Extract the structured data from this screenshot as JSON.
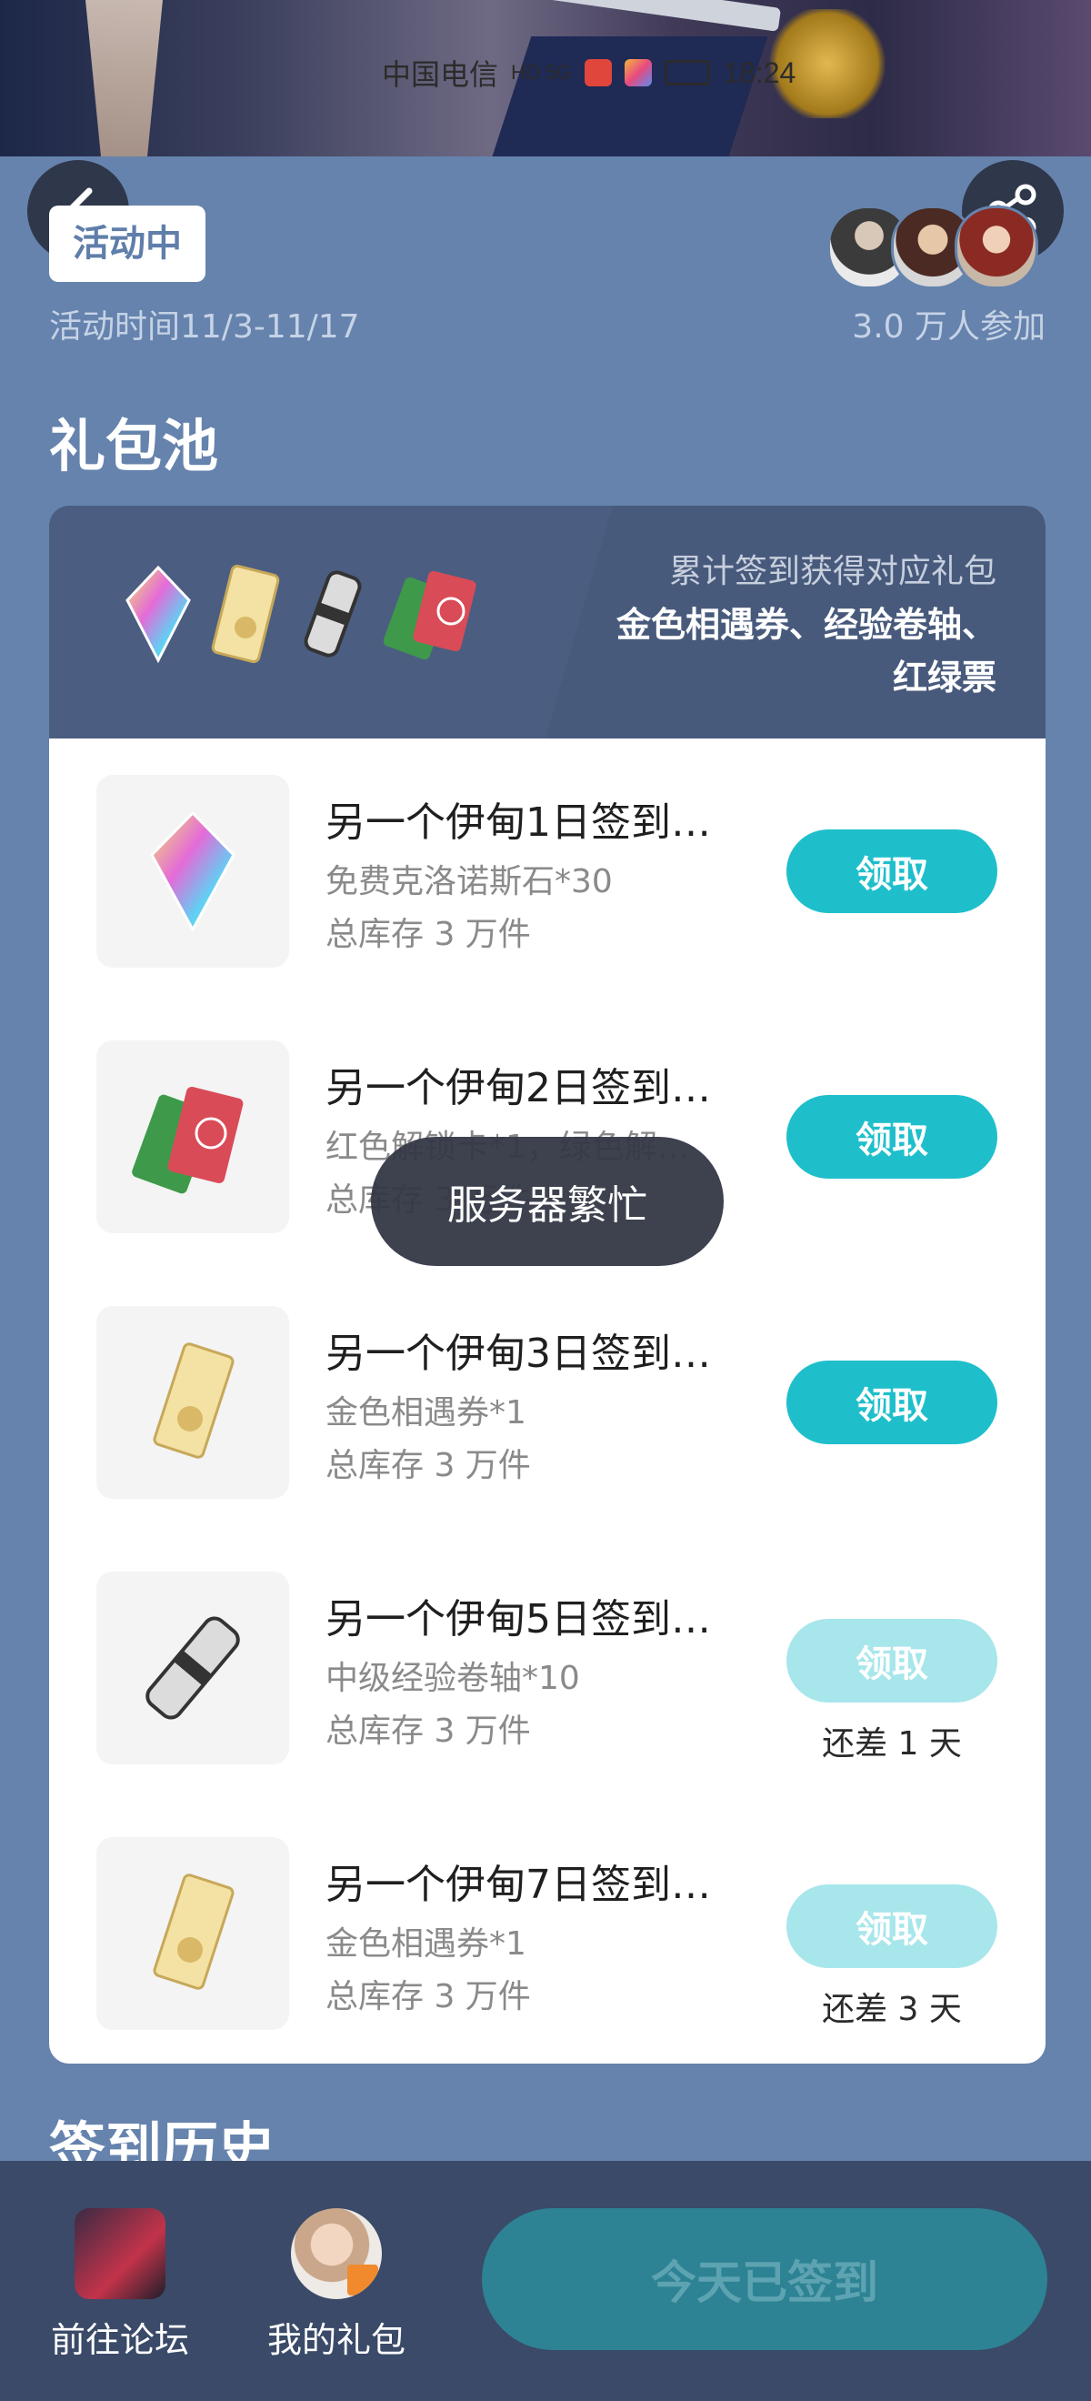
{
  "status_bar": {
    "carrier": "中国电信",
    "network": "HD 5G",
    "time": "18:24"
  },
  "activity": {
    "status_badge": "活动中",
    "time_range": "活动时间11/3-11/17",
    "participants": "3.0 万人参加"
  },
  "gift_pool": {
    "title": "礼包池",
    "subtitle": "累计签到获得对应礼包",
    "highlight_line1": "金色相遇券、经验卷轴、",
    "highlight_line2": "红绿票",
    "items": [
      {
        "title": "另一个伊甸1日签到…",
        "desc": "免费克洛诺斯石*30",
        "stock": "总库存 3 万件",
        "button": "领取",
        "enabled": true,
        "remain": "",
        "icon": "crystal-icon"
      },
      {
        "title": "另一个伊甸2日签到…",
        "desc": "红色解锁卡*1，绿色解…",
        "stock": "总库存 3 万件",
        "button": "领取",
        "enabled": true,
        "remain": "",
        "icon": "cards-icon"
      },
      {
        "title": "另一个伊甸3日签到…",
        "desc": "金色相遇券*1",
        "stock": "总库存 3 万件",
        "button": "领取",
        "enabled": true,
        "remain": "",
        "icon": "ticket-icon"
      },
      {
        "title": "另一个伊甸5日签到…",
        "desc": "中级经验卷轴*10",
        "stock": "总库存 3 万件",
        "button": "领取",
        "enabled": false,
        "remain": "还差 1 天",
        "icon": "scroll-icon"
      },
      {
        "title": "另一个伊甸7日签到…",
        "desc": "金色相遇券*1",
        "stock": "总库存 3 万件",
        "button": "领取",
        "enabled": false,
        "remain": "还差 3 天",
        "icon": "ticket-icon"
      }
    ]
  },
  "toast": "服务器繁忙",
  "history_title": "签到历史",
  "bottom_bar": {
    "forum_label": "前往论坛",
    "gifts_label": "我的礼包",
    "signed_label": "今天已签到"
  },
  "colors": {
    "page_bg": "#6583ad",
    "accent": "#1ebfcb",
    "accent_disabled": "#a7e6eb",
    "bottom_bar": "#3a4a68"
  }
}
